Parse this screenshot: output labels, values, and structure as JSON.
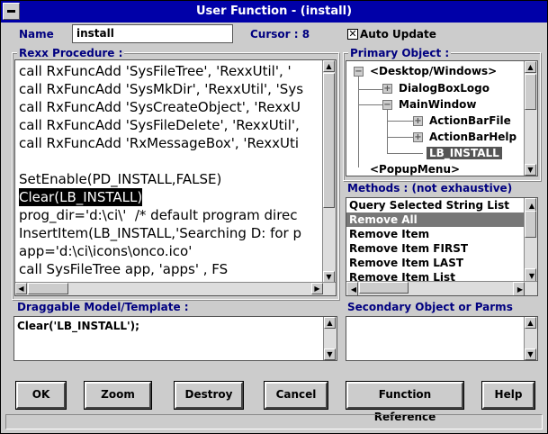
{
  "window": {
    "title": "User Function - (install)"
  },
  "name": {
    "label": "Name",
    "value": "install"
  },
  "cursor": {
    "label": "Cursor : 8"
  },
  "auto_update": {
    "label": "Auto Update",
    "checked": true
  },
  "rexx": {
    "label": "Rexx Procedure :",
    "lines": [
      "call RxFuncAdd 'SysFileTree', 'RexxUtil', '",
      "call RxFuncAdd 'SysMkDir', 'RexxUtil', 'Sys",
      "call RxFuncAdd 'SysCreateObject', 'RexxU",
      "call RxFuncAdd 'SysFileDelete', 'RexxUtil',",
      "call RxFuncAdd 'RxMessageBox', 'RexxUti",
      "",
      "SetEnable(PD_INSTALL,FALSE)",
      "Clear(LB_INSTALL)",
      "prog_dir='d:\\ci\\'  /* default program direc",
      "InsertItem(LB_INSTALL,'Searching D: for p",
      "app='d:\\ci\\icons\\onco.ico'",
      "call SysFileTree app, 'apps' , FS"
    ],
    "selected_index": 7
  },
  "primary": {
    "label": "Primary Object :",
    "tree": [
      "<Desktop/Windows>",
      "DialogBoxLogo",
      "MainWindow",
      "ActionBarFile",
      "ActionBarHelp",
      "LB_INSTALL",
      "<PopupMenu>"
    ]
  },
  "methods": {
    "label": "Methods : (not exhaustive)",
    "items": [
      "Query Selected String List",
      "Remove All",
      "Remove Item",
      "Remove Item FIRST",
      "Remove Item LAST",
      "Remove Item List"
    ],
    "selected_index": 1
  },
  "draggable": {
    "label": "Draggable Model/Template :",
    "value": "Clear('LB_INSTALL');"
  },
  "secondary": {
    "label": "Secondary Object or Parms",
    "value": ""
  },
  "buttons": {
    "ok": "OK",
    "zoom": "Zoom",
    "destroy": "Destroy",
    "cancel": "Cancel",
    "function_reference": "Function Reference",
    "help": "Help"
  }
}
